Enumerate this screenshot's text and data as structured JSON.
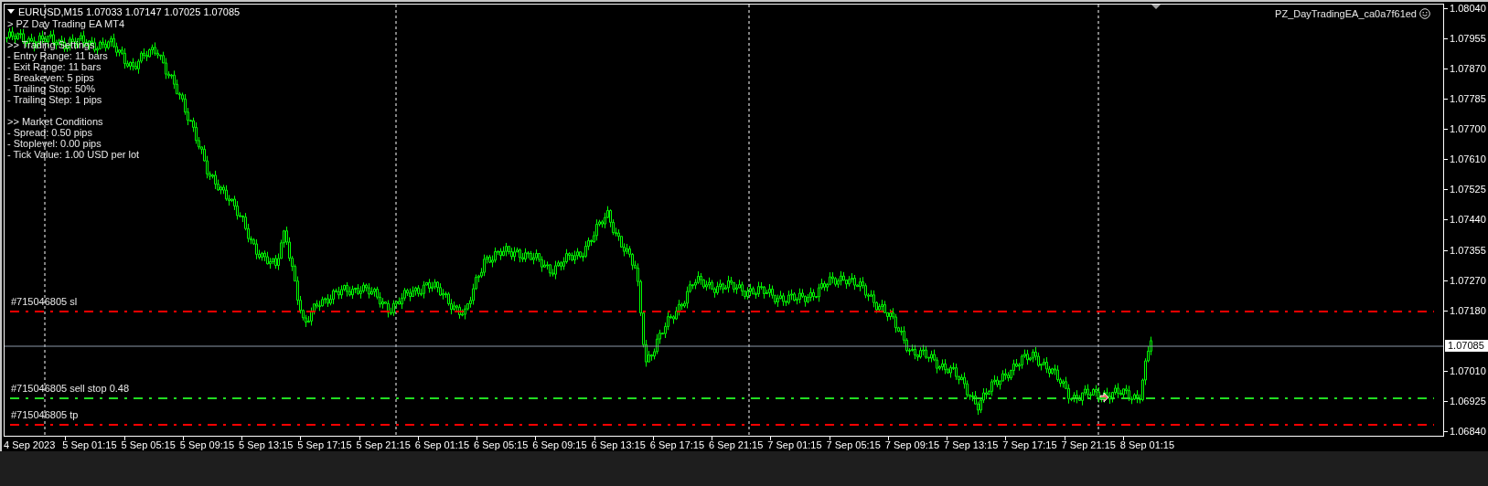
{
  "chart_header": {
    "symbol_line": "EURUSD,M15  1.07033 1.07147 1.07025 1.07085",
    "ea_title": "> PZ Day Trading EA MT4"
  },
  "info_panel": {
    "sections": [
      {
        "heading": ">> Trading Settings",
        "lines": [
          "- Entry Range: 11 bars",
          "- Exit Range: 11 bars",
          "- Breakeven: 5 pips",
          "- Trailing Stop: 50%",
          "- Trailing Step: 1 pips"
        ]
      },
      {
        "heading": ">> Market Conditions",
        "lines": [
          "- Spread: 0.50 pips",
          "- Stoplevel: 0.00 pips",
          "- Tick Value: 1.00 USD per lot"
        ]
      }
    ]
  },
  "expert_label": "PZ_DayTradingEA_ca0a7f61ed",
  "order_lines": [
    {
      "label": "#715046805 sl",
      "color": "#ff0000"
    },
    {
      "label": "#715046805 sell stop 0.48",
      "color": "#22dd22"
    },
    {
      "label": "#715046805 tp",
      "color": "#ff0000"
    }
  ],
  "price_axis": {
    "ticks": [
      "1.08040",
      "1.07955",
      "1.07870",
      "1.07785",
      "1.07700",
      "1.07610",
      "1.07525",
      "1.07440",
      "1.07355",
      "1.07270",
      "1.07180",
      "1.07010",
      "1.06925",
      "1.06840"
    ],
    "current_price": "1.07085"
  },
  "time_axis": {
    "labels": [
      "4 Sep 2023",
      "5 Sep 01:15",
      "5 Sep 05:15",
      "5 Sep 09:15",
      "5 Sep 13:15",
      "5 Sep 17:15",
      "5 Sep 21:15",
      "6 Sep 01:15",
      "6 Sep 05:15",
      "6 Sep 09:15",
      "6 Sep 13:15",
      "6 Sep 17:15",
      "6 Sep 21:15",
      "7 Sep 01:15",
      "7 Sep 05:15",
      "7 Sep 09:15",
      "7 Sep 13:15",
      "7 Sep 17:15",
      "7 Sep 21:15",
      "8 Sep 01:15"
    ]
  }
}
